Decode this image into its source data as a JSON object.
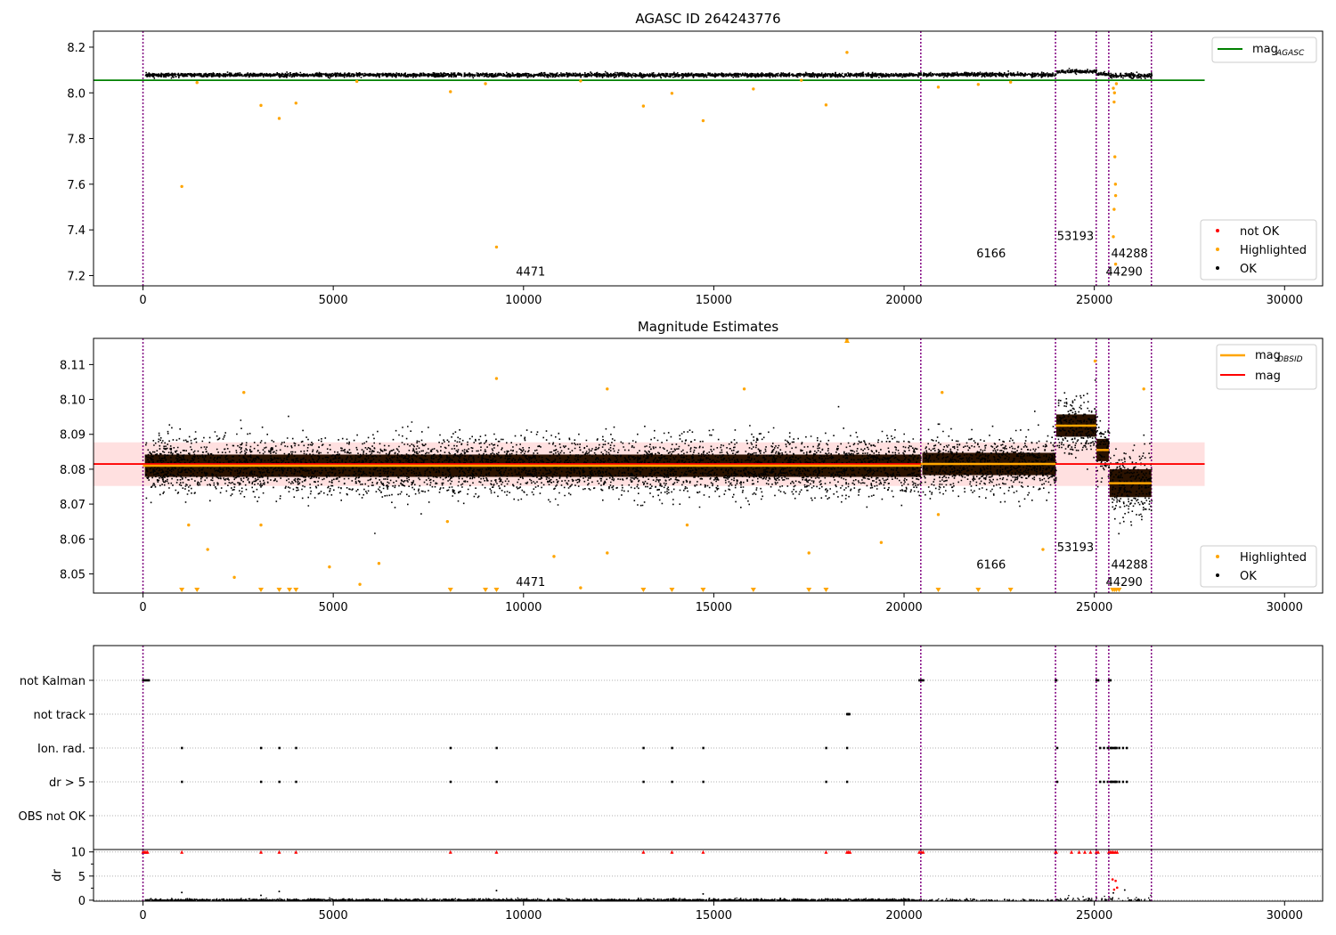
{
  "colors": {
    "ok": "#000000",
    "highlighted": "#ffa500",
    "not_ok": "#ff0000",
    "mag_agasc_line": "#008000",
    "mag_line": "#ff0000",
    "mag_obsid_line": "#ffa500",
    "band_fill": "#ffd6d6",
    "obsid_boundary": "#800080",
    "dense_core": "#2a1200"
  },
  "chart_data": [
    {
      "id": "agasc",
      "type": "scatter",
      "title": "AGASC ID 264243776",
      "xlim": [
        -1300,
        31000
      ],
      "ylim": [
        7.155,
        8.27
      ],
      "xticks": [
        0,
        5000,
        10000,
        15000,
        20000,
        25000,
        30000
      ],
      "xtick_labels": [
        "0",
        "5000",
        "10000",
        "15000",
        "20000",
        "25000",
        "30000"
      ],
      "yticks": [
        7.2,
        7.4,
        7.6,
        7.8,
        8.0,
        8.2
      ],
      "ytick_labels": [
        "7.2",
        "7.4",
        "7.6",
        "7.8",
        "8.0",
        "8.2"
      ],
      "obsid_boundaries": [
        0,
        20440,
        23980,
        25050,
        25380,
        26500
      ],
      "mag_agasc": 8.055,
      "ok_segments": [
        {
          "x": [
            50,
            20440
          ],
          "center": 8.081,
          "spread": 0.004
        },
        {
          "x": [
            20480,
            23980
          ],
          "center": 8.083,
          "spread": 0.004
        },
        {
          "x": [
            24000,
            25050
          ],
          "center": 8.096,
          "spread": 0.004
        },
        {
          "x": [
            25060,
            25380
          ],
          "center": 8.086,
          "spread": 0.004
        },
        {
          "x": [
            25400,
            26500
          ],
          "center": 8.078,
          "spread": 0.005
        }
      ],
      "highlighted_points": [
        {
          "x": 1020,
          "y": 7.59
        },
        {
          "x": 3100,
          "y": 7.945
        },
        {
          "x": 3580,
          "y": 7.888
        },
        {
          "x": 4020,
          "y": 7.955
        },
        {
          "x": 9290,
          "y": 7.325
        },
        {
          "x": 8080,
          "y": 8.005
        },
        {
          "x": 13150,
          "y": 7.942
        },
        {
          "x": 13900,
          "y": 7.998
        },
        {
          "x": 14720,
          "y": 7.878
        },
        {
          "x": 16040,
          "y": 8.017
        },
        {
          "x": 17950,
          "y": 7.947
        },
        {
          "x": 18500,
          "y": 8.177
        },
        {
          "x": 20900,
          "y": 8.025
        },
        {
          "x": 21950,
          "y": 8.037
        },
        {
          "x": 1420,
          "y": 8.045
        },
        {
          "x": 5620,
          "y": 8.05
        },
        {
          "x": 9000,
          "y": 8.04
        },
        {
          "x": 11500,
          "y": 8.052
        },
        {
          "x": 17300,
          "y": 8.055
        },
        {
          "x": 22800,
          "y": 8.047
        },
        {
          "x": 25500,
          "y": 8.02
        },
        {
          "x": 25520,
          "y": 7.96
        },
        {
          "x": 25540,
          "y": 7.72
        },
        {
          "x": 25555,
          "y": 7.6
        },
        {
          "x": 25560,
          "y": 7.55
        },
        {
          "x": 25520,
          "y": 7.49
        },
        {
          "x": 25500,
          "y": 7.37
        },
        {
          "x": 25560,
          "y": 7.25
        },
        {
          "x": 25530,
          "y": 8.0
        },
        {
          "x": 25580,
          "y": 8.04
        }
      ],
      "annotations": [
        {
          "text": "4471",
          "x": 9800,
          "y": 7.2
        },
        {
          "text": "6166",
          "x": 21900,
          "y": 7.28
        },
        {
          "text": "53193",
          "x": 24020,
          "y": 7.355
        },
        {
          "text": "44290",
          "x": 25300,
          "y": 7.2
        },
        {
          "text": "44288",
          "x": 25440,
          "y": 7.28
        }
      ],
      "legend_top": {
        "placement": "top-right",
        "entries": [
          {
            "label": "mag",
            "subscript": "AGASC"
          }
        ]
      },
      "legend_bottom": {
        "placement": "bottom-right",
        "entries": [
          "not OK",
          "Highlighted",
          "OK"
        ]
      }
    },
    {
      "id": "estimates",
      "type": "scatter",
      "title": "Magnitude Estimates",
      "xlim": [
        -1300,
        31000
      ],
      "ylim": [
        8.0445,
        8.1175
      ],
      "xticks": [
        0,
        5000,
        10000,
        15000,
        20000,
        25000,
        30000
      ],
      "xtick_labels": [
        "0",
        "5000",
        "10000",
        "15000",
        "20000",
        "25000",
        "30000"
      ],
      "yticks": [
        8.05,
        8.06,
        8.07,
        8.08,
        8.09,
        8.1,
        8.11
      ],
      "ytick_labels": [
        "8.05",
        "8.06",
        "8.07",
        "8.08",
        "8.09",
        "8.10",
        "8.11"
      ],
      "obsid_boundaries": [
        0,
        20440,
        23980,
        25050,
        25380,
        26500
      ],
      "mag": 8.0815,
      "mag_band": [
        8.0752,
        8.0877
      ],
      "mag_obsid": [
        {
          "x": [
            0,
            20440
          ],
          "y": 8.081
        },
        {
          "x": [
            20440,
            23980
          ],
          "y": 8.0815
        },
        {
          "x": [
            23980,
            25050
          ],
          "y": 8.0925
        },
        {
          "x": [
            25050,
            25380
          ],
          "y": 8.0855
        },
        {
          "x": [
            25380,
            26500
          ],
          "y": 8.076
        }
      ],
      "ok_segments": [
        {
          "x": [
            50,
            20440
          ],
          "center": 8.081,
          "spread": 0.004
        },
        {
          "x": [
            20480,
            23980
          ],
          "center": 8.0815,
          "spread": 0.004
        },
        {
          "x": [
            24000,
            25050
          ],
          "center": 8.0925,
          "spread": 0.004
        },
        {
          "x": [
            25060,
            25380
          ],
          "center": 8.0855,
          "spread": 0.004
        },
        {
          "x": [
            25400,
            26500
          ],
          "center": 8.076,
          "spread": 0.005
        }
      ],
      "highlighted_points": [
        {
          "x": 18500,
          "y": 8.117
        },
        {
          "x": 9290,
          "y": 8.106
        },
        {
          "x": 25020,
          "y": 8.111
        },
        {
          "x": 12200,
          "y": 8.103
        },
        {
          "x": 15800,
          "y": 8.103
        },
        {
          "x": 2650,
          "y": 8.102
        },
        {
          "x": 21000,
          "y": 8.102
        },
        {
          "x": 26300,
          "y": 8.103
        },
        {
          "x": 8000,
          "y": 8.065
        },
        {
          "x": 1200,
          "y": 8.064
        },
        {
          "x": 1700,
          "y": 8.057
        },
        {
          "x": 2400,
          "y": 8.049
        },
        {
          "x": 4900,
          "y": 8.052
        },
        {
          "x": 5700,
          "y": 8.047
        },
        {
          "x": 6200,
          "y": 8.053
        },
        {
          "x": 10800,
          "y": 8.055
        },
        {
          "x": 11500,
          "y": 8.046
        },
        {
          "x": 12200,
          "y": 8.056
        },
        {
          "x": 17500,
          "y": 8.056
        },
        {
          "x": 19400,
          "y": 8.059
        },
        {
          "x": 23650,
          "y": 8.057
        },
        {
          "x": 3100,
          "y": 8.064
        },
        {
          "x": 14300,
          "y": 8.064
        },
        {
          "x": 20900,
          "y": 8.067
        }
      ],
      "clipped_low_x": [
        1020,
        1420,
        3100,
        3580,
        3850,
        4020,
        8080,
        9000,
        9290,
        13150,
        13900,
        14720,
        16040,
        17950,
        17500,
        20900,
        21950,
        22800,
        25480,
        25530,
        25580,
        25650
      ],
      "annotations": [
        {
          "text": "4471",
          "x": 9800,
          "y": 8.0465
        },
        {
          "text": "6166",
          "x": 21900,
          "y": 8.0515
        },
        {
          "text": "53193",
          "x": 24020,
          "y": 8.0565
        },
        {
          "text": "44290",
          "x": 25300,
          "y": 8.0465
        },
        {
          "text": "44288",
          "x": 25440,
          "y": 8.0515
        }
      ],
      "legend_top": {
        "placement": "top-right",
        "entries": [
          {
            "label": "mag",
            "subscript": "OBSID"
          },
          {
            "label": "mag",
            "subscript": ""
          }
        ]
      },
      "legend_bottom": {
        "placement": "bottom-right",
        "entries": [
          "Highlighted",
          "OK"
        ]
      }
    },
    {
      "id": "flags",
      "type": "scatter",
      "title": "",
      "xlim": [
        -1300,
        31000
      ],
      "categories": [
        "not Kalman",
        "not track",
        "Ion. rad.",
        "dr > 5",
        "OBS not OK"
      ],
      "obsid_boundaries": [
        0,
        20440,
        23980,
        25050,
        25380,
        26500
      ],
      "flag_points": {
        "not Kalman": [
          0,
          50,
          100,
          150,
          20400,
          20450,
          20500,
          23980,
          24000,
          25050,
          25100,
          25380,
          25420
        ],
        "not track": [
          18500,
          18520,
          18540,
          18560
        ],
        "Ion. rad.": [
          1020,
          3100,
          3580,
          4020,
          8080,
          9290,
          13150,
          13900,
          14720,
          17950,
          18500,
          24020,
          25150,
          25250,
          25350,
          25450,
          25550,
          25650,
          25750,
          25850,
          25420,
          25480,
          25530,
          25580
        ],
        "dr > 5": [
          1020,
          3100,
          3580,
          4020,
          8080,
          9290,
          13150,
          13900,
          14720,
          17950,
          18500,
          24020,
          25150,
          25250,
          25350,
          25450,
          25550,
          25650,
          25750,
          25850,
          25420,
          25480,
          25530,
          25580
        ],
        "OBS not OK": []
      }
    },
    {
      "id": "dr",
      "type": "scatter",
      "title": "",
      "ylabel": "dr",
      "xlim": [
        -1300,
        31000
      ],
      "ylim": [
        -0.2,
        10.5
      ],
      "yticks": [
        0,
        5,
        10
      ],
      "ytick_labels": [
        "0",
        "5",
        "10"
      ],
      "xticks": [
        0,
        5000,
        10000,
        15000,
        20000,
        25000,
        30000
      ],
      "xtick_labels": [
        "0",
        "5000",
        "10000",
        "15000",
        "20000",
        "25000",
        "30000"
      ],
      "obsid_boundaries": [
        0,
        20440,
        23980,
        25050,
        25380,
        26500
      ],
      "capped_red_x": [
        0,
        40,
        80,
        120,
        1020,
        3100,
        3580,
        4020,
        8080,
        9290,
        13150,
        13900,
        14720,
        17950,
        18500,
        18540,
        18580,
        20400,
        20450,
        20500,
        23980,
        24000,
        24400,
        24600,
        24750,
        24900,
        25050,
        25100,
        25380,
        25420,
        25460,
        25500,
        25550,
        25600
      ],
      "red_points": [
        {
          "x": 25480,
          "y": 4.3
        },
        {
          "x": 25560,
          "y": 4.0
        },
        {
          "x": 25600,
          "y": 2.6
        },
        {
          "x": 25520,
          "y": 2.2
        }
      ],
      "black_extra": [
        {
          "x": 1020,
          "y": 1.6
        },
        {
          "x": 3100,
          "y": 1.0
        },
        {
          "x": 3580,
          "y": 1.8
        },
        {
          "x": 9290,
          "y": 2.0
        },
        {
          "x": 25800,
          "y": 2.1
        },
        {
          "x": 25500,
          "y": 1.5
        },
        {
          "x": 14720,
          "y": 1.3
        }
      ]
    }
  ]
}
